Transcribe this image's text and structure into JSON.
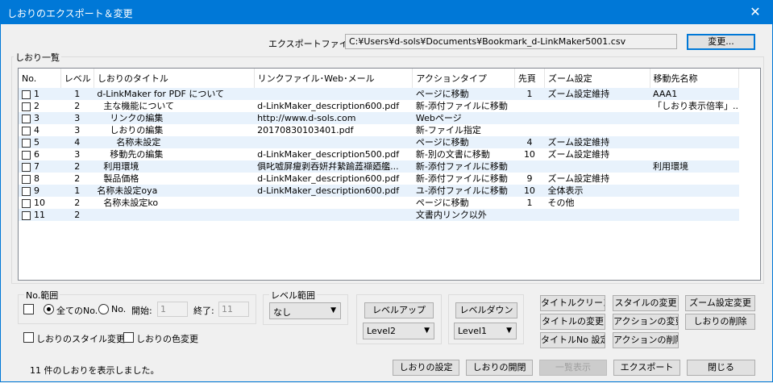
{
  "window": {
    "title": "しおりのエクスポート＆変更",
    "close_glyph": "✕"
  },
  "export": {
    "label": "エクスポートファイル:",
    "path": "C:¥Users¥d-sols¥Documents¥Bookmark_d-LinkMaker5001.csv",
    "change_button": "変更..."
  },
  "list": {
    "group_title": "しおり一覧",
    "columns": [
      "No.",
      "レベル",
      "しおりのタイトル",
      "リンクファイル･Web･メール",
      "アクションタイプ",
      "先頁",
      "ズーム設定",
      "移動先名称"
    ],
    "rows": [
      {
        "no": "1",
        "level": "1",
        "title": "d-LinkMaker for PDF について",
        "indent": 0,
        "link": "",
        "action": "ページに移動",
        "page": "1",
        "zoom": "ズーム設定維持",
        "dest": "AAA1"
      },
      {
        "no": "2",
        "level": "2",
        "title": "主な機能について",
        "indent": 1,
        "link": "d-LinkMaker_description600.pdf",
        "action": "新-添付ファイルに移動",
        "page": "",
        "zoom": "",
        "dest": "「しおり表示倍率」..."
      },
      {
        "no": "3",
        "level": "3",
        "title": "リンクの編集",
        "indent": 2,
        "link": "http://www.d-sols.com",
        "action": "Webページ",
        "page": "",
        "zoom": "",
        "dest": ""
      },
      {
        "no": "4",
        "level": "3",
        "title": "しおりの編集",
        "indent": 2,
        "link": "20170830103401.pdf",
        "action": "新-ファイル指定",
        "page": "",
        "zoom": "",
        "dest": ""
      },
      {
        "no": "5",
        "level": "4",
        "title": "名称未設定",
        "indent": 3,
        "link": "",
        "action": "ページに移動",
        "page": "4",
        "zoom": "ズーム設定維持",
        "dest": ""
      },
      {
        "no": "6",
        "level": "3",
        "title": "移動先の編集",
        "indent": 2,
        "link": "d-LinkMaker_description500.pdf",
        "action": "新-別の文書に移動",
        "page": "10",
        "zoom": "ズーム設定維持",
        "dest": ""
      },
      {
        "no": "7",
        "level": "2",
        "title": "利用環境",
        "indent": 1,
        "link": "俱叱嘘屏瘦剥吞妍幷縶踰蕋襭廼艦...",
        "action": "新-添付ファイルに移動",
        "page": "",
        "zoom": "",
        "dest": "利用環境"
      },
      {
        "no": "8",
        "level": "2",
        "title": "製品価格",
        "indent": 1,
        "link": "d-LinkMaker_description600.pdf",
        "action": "新-添付ファイルに移動",
        "page": "9",
        "zoom": "ズーム設定維持",
        "dest": ""
      },
      {
        "no": "9",
        "level": "1",
        "title": "名称未設定oya",
        "indent": 0,
        "link": "d-LinkMaker_description600.pdf",
        "action": "ユ-添付ファイルに移動",
        "page": "10",
        "zoom": "全体表示",
        "dest": ""
      },
      {
        "no": "10",
        "level": "2",
        "title": "名称未設定ko",
        "indent": 1,
        "link": "",
        "action": "ページに移動",
        "page": "1",
        "zoom": "その他",
        "dest": ""
      },
      {
        "no": "11",
        "level": "2",
        "title": "",
        "indent": 0,
        "link": "",
        "action": "文書内リンク以外",
        "page": "",
        "zoom": "",
        "dest": ""
      }
    ]
  },
  "no_range": {
    "group_title": "No.範囲",
    "all_label": "全てのNo.",
    "no_label": "No.",
    "start_label": "開始:",
    "start_value": "1",
    "end_label": "終了:",
    "end_value": "11",
    "all_selected": true
  },
  "level_range": {
    "group_title": "レベル範囲",
    "selected": "なし"
  },
  "level_up": {
    "button": "レベルアップ",
    "selected": "Level2"
  },
  "level_down": {
    "button": "レベルダウン",
    "selected": "Level1"
  },
  "options": {
    "style_change": "しおりのスタイル変更",
    "color_change": "しおりの色変更"
  },
  "actions": {
    "title_clean": "タイトルクリーン",
    "style_change": "スタイルの変更",
    "zoom_change": "ズーム設定変更",
    "title_change": "タイトルの変更",
    "action_change": "アクションの変更",
    "delete_bookmark": "しおりの削除",
    "title_no_setting": "タイトルNo 設定",
    "delete_action": "アクションの削除"
  },
  "footer": {
    "status": "11 件のしおりを表示しました。",
    "bookmark_settings": "しおりの設定",
    "bookmark_open_close": "しおりの開閉",
    "list_view": "一覧表示",
    "export": "エクスポート",
    "close": "閉じる"
  }
}
